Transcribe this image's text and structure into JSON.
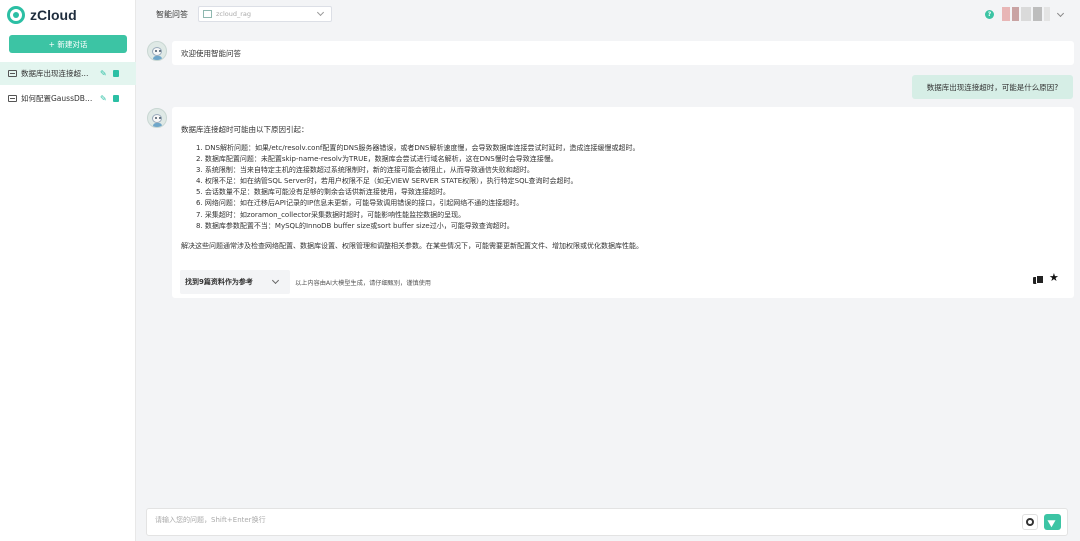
{
  "app": {
    "name": "zCloud"
  },
  "sidebar": {
    "new_chat_label": "+ 新建对话",
    "conversations": [
      {
        "label": "数据库出现连接超时，可能是什么原因?",
        "active": true
      },
      {
        "label": "如何配置GaussDB数据库?",
        "active": false
      }
    ]
  },
  "header": {
    "title": "智能问答",
    "knowledge_base": "zcloud_rag",
    "help_icon": "question-circle-icon",
    "user_menu_icon": "chevron-down-icon"
  },
  "chat": {
    "greeting": "欢迎使用智能问答",
    "user_question": "数据库出现连接超时，可能是什么原因?",
    "answer": {
      "intro": "数据库连接超时可能由以下原因引起：",
      "items": [
        "1. DNS解析问题：如果/etc/resolv.conf配置的DNS服务器错误，或者DNS解析速度慢，会导致数据库连接尝试时延时，造成连接缓慢或超时。",
        "2. 数据库配置问题：未配置skip-name-resolv为TRUE，数据库会尝试进行域名解析，这在DNS慢时会导致连接慢。",
        "3. 系统限制：当来自特定主机的连接数超过系统限制时，新的连接可能会被阻止，从而导致通信失败和超时。",
        "4. 权限不足：如在纳管SQL Server时，若用户权限不足（如无VIEW SERVER STATE权限），执行特定SQL查询时会超时。",
        "5. 会话数量不足：数据库可能没有足够的剩余会话供新连接使用，导致连接超时。",
        "6. 网络问题：如在迁移后API记录的IP信息未更新，可能导致调用错误的接口，引起网络不通的连接超时。",
        "7. 采集超时：如zoramon_collector采集数据时超时，可能影响性能监控数据的呈现。",
        "8. 数据库参数配置不当：MySQL的InnoDB buffer size或sort buffer size过小，可能导致查询超时。"
      ],
      "summary": "解决这些问题通常涉及检查网络配置、数据库设置、权限管理和调整相关参数。在某些情况下，可能需要更新配置文件、增加权限或优化数据库性能。",
      "references_label": "找到9篇资料作为参考",
      "ai_note": "以上内容由AI大模型生成，请仔细甄别，谨慎使用"
    }
  },
  "input": {
    "placeholder": "请输入您的问题，Shift+Enter换行",
    "value": ""
  },
  "colors": {
    "accent": "#3cc4a4",
    "active_conversation_bg": "#e3f5ef",
    "user_bubble_bg": "#d6eee6",
    "page_bg": "#f3f4f6"
  }
}
